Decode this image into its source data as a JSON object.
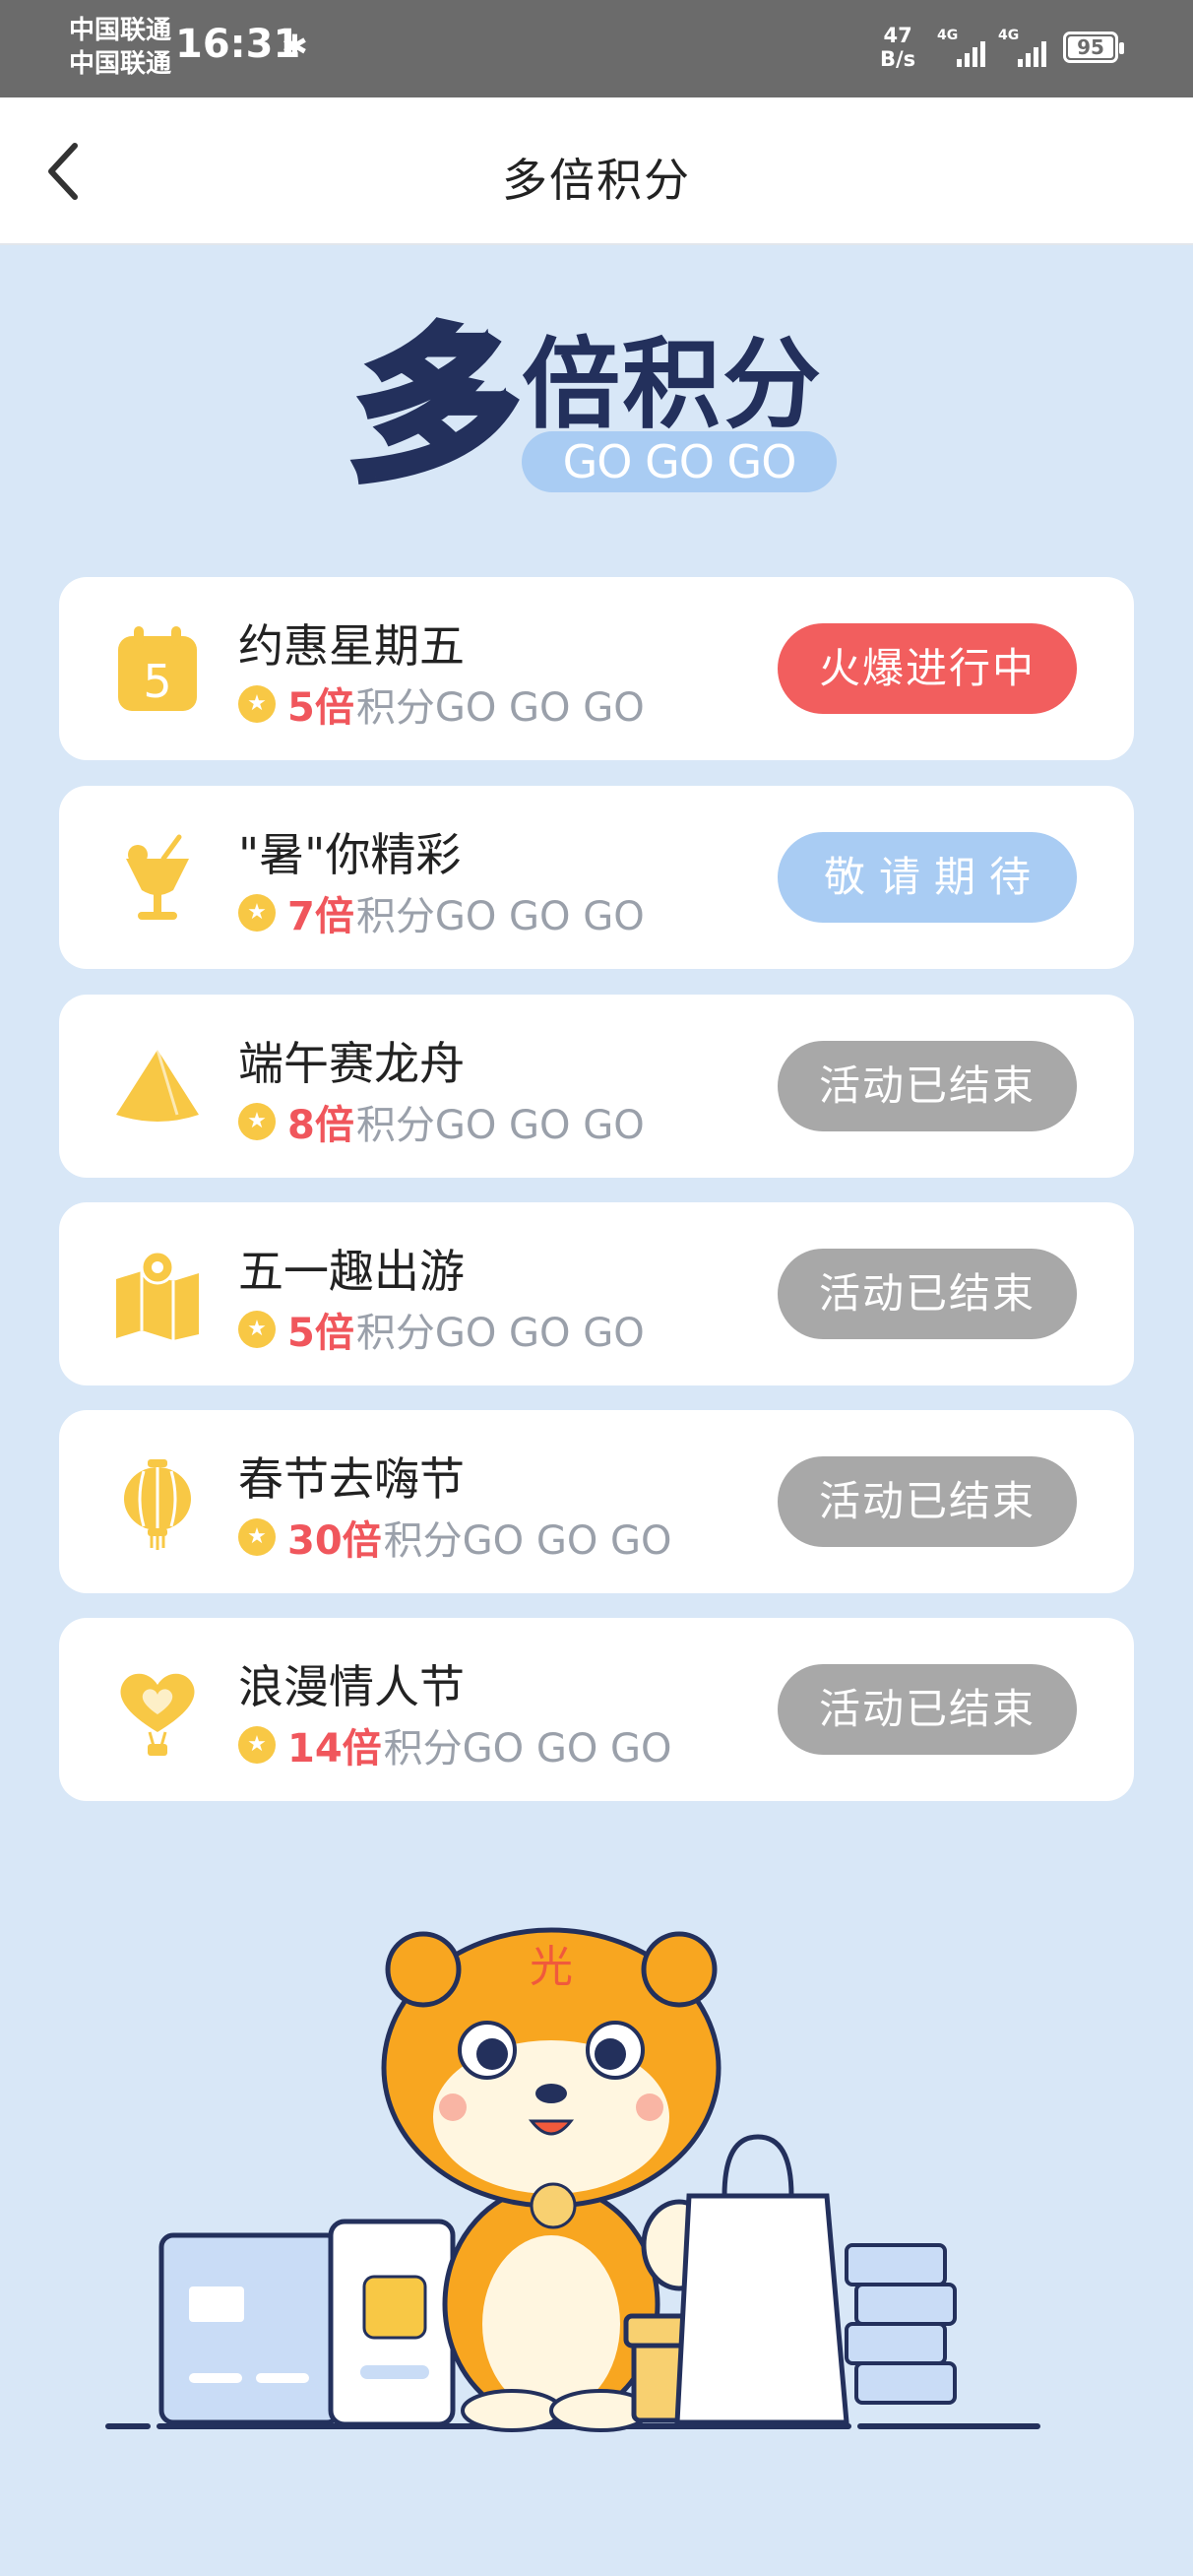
{
  "status_bar": {
    "carrier_1": "中国联通",
    "carrier_2": "中国联通",
    "time": "16:31",
    "net_speed_value": "47",
    "net_speed_unit": "B/s",
    "network_1": "4G",
    "network_2": "4G",
    "battery": "95"
  },
  "nav": {
    "title": "多倍积分"
  },
  "banner": {
    "big_char": "多",
    "rest_text": "倍积分",
    "tagline": "GO GO GO"
  },
  "activities": [
    {
      "title": "约惠星期五",
      "multiplier": "5倍",
      "suffix": "积分GO GO GO",
      "status": "火爆进行中",
      "icon": "calendar-icon"
    },
    {
      "title": "\"暑\"你精彩",
      "multiplier": "7倍",
      "suffix": "积分GO GO GO",
      "status": "敬请期待",
      "icon": "drink-icon"
    },
    {
      "title": "端午赛龙舟",
      "multiplier": "8倍",
      "suffix": "积分GO GO GO",
      "status": "活动已结束",
      "icon": "zongzi-icon"
    },
    {
      "title": "五一趣出游",
      "multiplier": "5倍",
      "suffix": "积分GO GO GO",
      "status": "活动已结束",
      "icon": "map-icon"
    },
    {
      "title": "春节去嗨节",
      "multiplier": "30倍",
      "suffix": "积分GO GO GO",
      "status": "活动已结束",
      "icon": "lantern-icon"
    },
    {
      "title": "浪漫情人节",
      "multiplier": "14倍",
      "suffix": "积分GO GO GO",
      "status": "活动已结束",
      "icon": "heart-balloon-icon"
    }
  ],
  "colors": {
    "page_bg": "#d8e7f7",
    "accent_red": "#f25e5e",
    "accent_blue": "#a9ccf3",
    "ended_gray": "#a8a8a8",
    "icon_yellow": "#f8c845",
    "navy": "#23305c"
  },
  "mascot": {
    "hat_char": "光"
  }
}
